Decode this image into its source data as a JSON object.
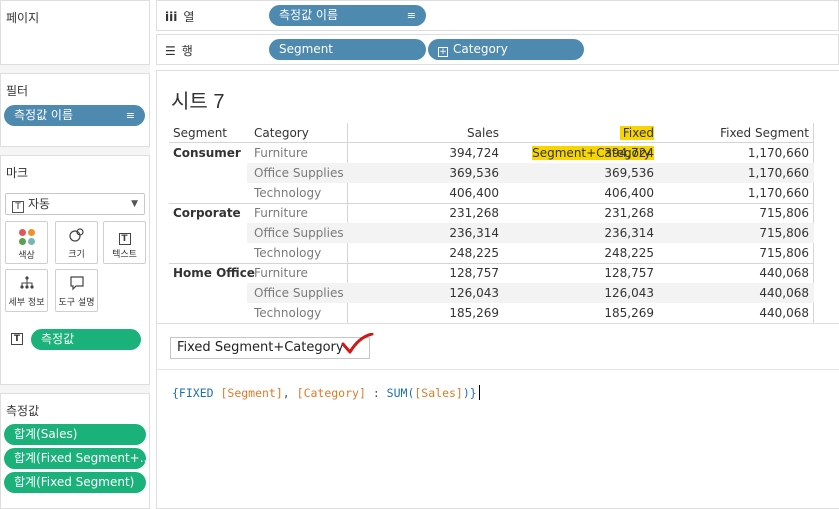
{
  "panes": {
    "pages": {
      "title": "페이지"
    },
    "filters": {
      "title": "필터",
      "pill": "측정값 이름"
    },
    "marks": {
      "title": "마크",
      "mark_type": "자동",
      "buttons": {
        "color": "색상",
        "size": "크기",
        "text": "텍스트",
        "detail": "세부 정보",
        "tooltip": "도구 설명"
      },
      "text_pill": "측정값"
    },
    "measure_values": {
      "title": "측정값",
      "pills": [
        "합계(Sales)",
        "합계(Fixed Segment+..",
        "합계(Fixed Segment)"
      ]
    }
  },
  "shelves": {
    "columns": {
      "label": "열",
      "pill": "측정값 이름"
    },
    "rows": {
      "label": "행",
      "pills": [
        "Segment",
        "Category"
      ]
    }
  },
  "sheet": {
    "title": "시트 7"
  },
  "table": {
    "headers": {
      "segment": "Segment",
      "category": "Category",
      "sales": "Sales",
      "fsc": "Fixed Segment+Category",
      "fs": "Fixed Segment"
    },
    "groups": [
      {
        "segment": "Consumer",
        "rows": [
          {
            "category": "Furniture",
            "sales": "394,724",
            "fsc": "394,724",
            "fs": "1,170,660"
          },
          {
            "category": "Office Supplies",
            "sales": "369,536",
            "fsc": "369,536",
            "fs": "1,170,660"
          },
          {
            "category": "Technology",
            "sales": "406,400",
            "fsc": "406,400",
            "fs": "1,170,660"
          }
        ]
      },
      {
        "segment": "Corporate",
        "rows": [
          {
            "category": "Furniture",
            "sales": "231,268",
            "fsc": "231,268",
            "fs": "715,806"
          },
          {
            "category": "Office Supplies",
            "sales": "236,314",
            "fsc": "236,314",
            "fs": "715,806"
          },
          {
            "category": "Technology",
            "sales": "248,225",
            "fsc": "248,225",
            "fs": "715,806"
          }
        ]
      },
      {
        "segment": "Home Office",
        "rows": [
          {
            "category": "Furniture",
            "sales": "128,757",
            "fsc": "128,757",
            "fs": "440,068"
          },
          {
            "category": "Office Supplies",
            "sales": "126,043",
            "fsc": "126,043",
            "fs": "440,068"
          },
          {
            "category": "Technology",
            "sales": "185,269",
            "fsc": "185,269",
            "fs": "440,068"
          }
        ]
      }
    ]
  },
  "calc": {
    "name": "Fixed Segment+Category",
    "formula": {
      "t1": "{FIXED ",
      "t2": "[Segment]",
      "t3": ", ",
      "t4": "[Category]",
      "t5": " : ",
      "t6": "SUM(",
      "t7": "[Sales]",
      "t8": ")}"
    }
  },
  "colors": {
    "pill_blue": "#4e8ab0",
    "pill_green": "#1ab27a",
    "highlight": "#f6d500",
    "checkmark": "#d01818"
  }
}
